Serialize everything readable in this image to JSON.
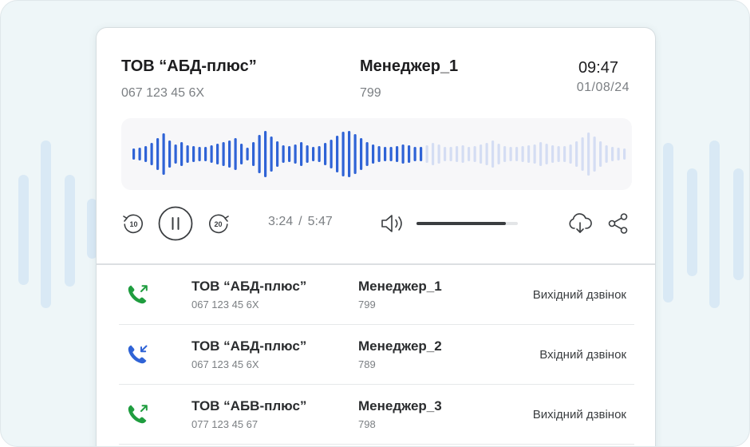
{
  "header": {
    "company": "ТОВ “АБД-плюс”",
    "phone": "067 123 45 6X",
    "manager": "Менеджер_1",
    "extension": "799",
    "time": "09:47",
    "date": "01/08/24"
  },
  "player": {
    "current_time": "3:24",
    "separator": "/",
    "total_time": "5:47",
    "progress": 0.59,
    "volume": 0.88,
    "rewind_seconds": "10",
    "forward_seconds": "20",
    "played_color": "#2f63d6",
    "unplayed_color": "#d4ddf3",
    "icons": [
      "rewind-10-icon",
      "pause-icon",
      "forward-20-icon",
      "volume-icon",
      "download-cloud-icon",
      "share-icon"
    ]
  },
  "calls": [
    {
      "company": "ТОВ “АБД-плюс”",
      "phone": "067 123 45 6X",
      "manager": "Менеджер_1",
      "extension": "799",
      "type": "Вихідний дзвінок",
      "direction": "outgoing",
      "icon_color": "#1f9d3f"
    },
    {
      "company": "ТОВ “АБД-плюс”",
      "phone": "067 123 45 6X",
      "manager": "Менеджер_2",
      "extension": "789",
      "type": "Вхідний дзвінок",
      "direction": "incoming",
      "icon_color": "#2f63d6"
    },
    {
      "company": "ТОВ “АБВ-плюс”",
      "phone": "077 123 45 67",
      "manager": "Менеджер_3",
      "extension": "798",
      "type": "Вихідний дзвінок",
      "direction": "outgoing",
      "icon_color": "#1f9d3f"
    }
  ]
}
